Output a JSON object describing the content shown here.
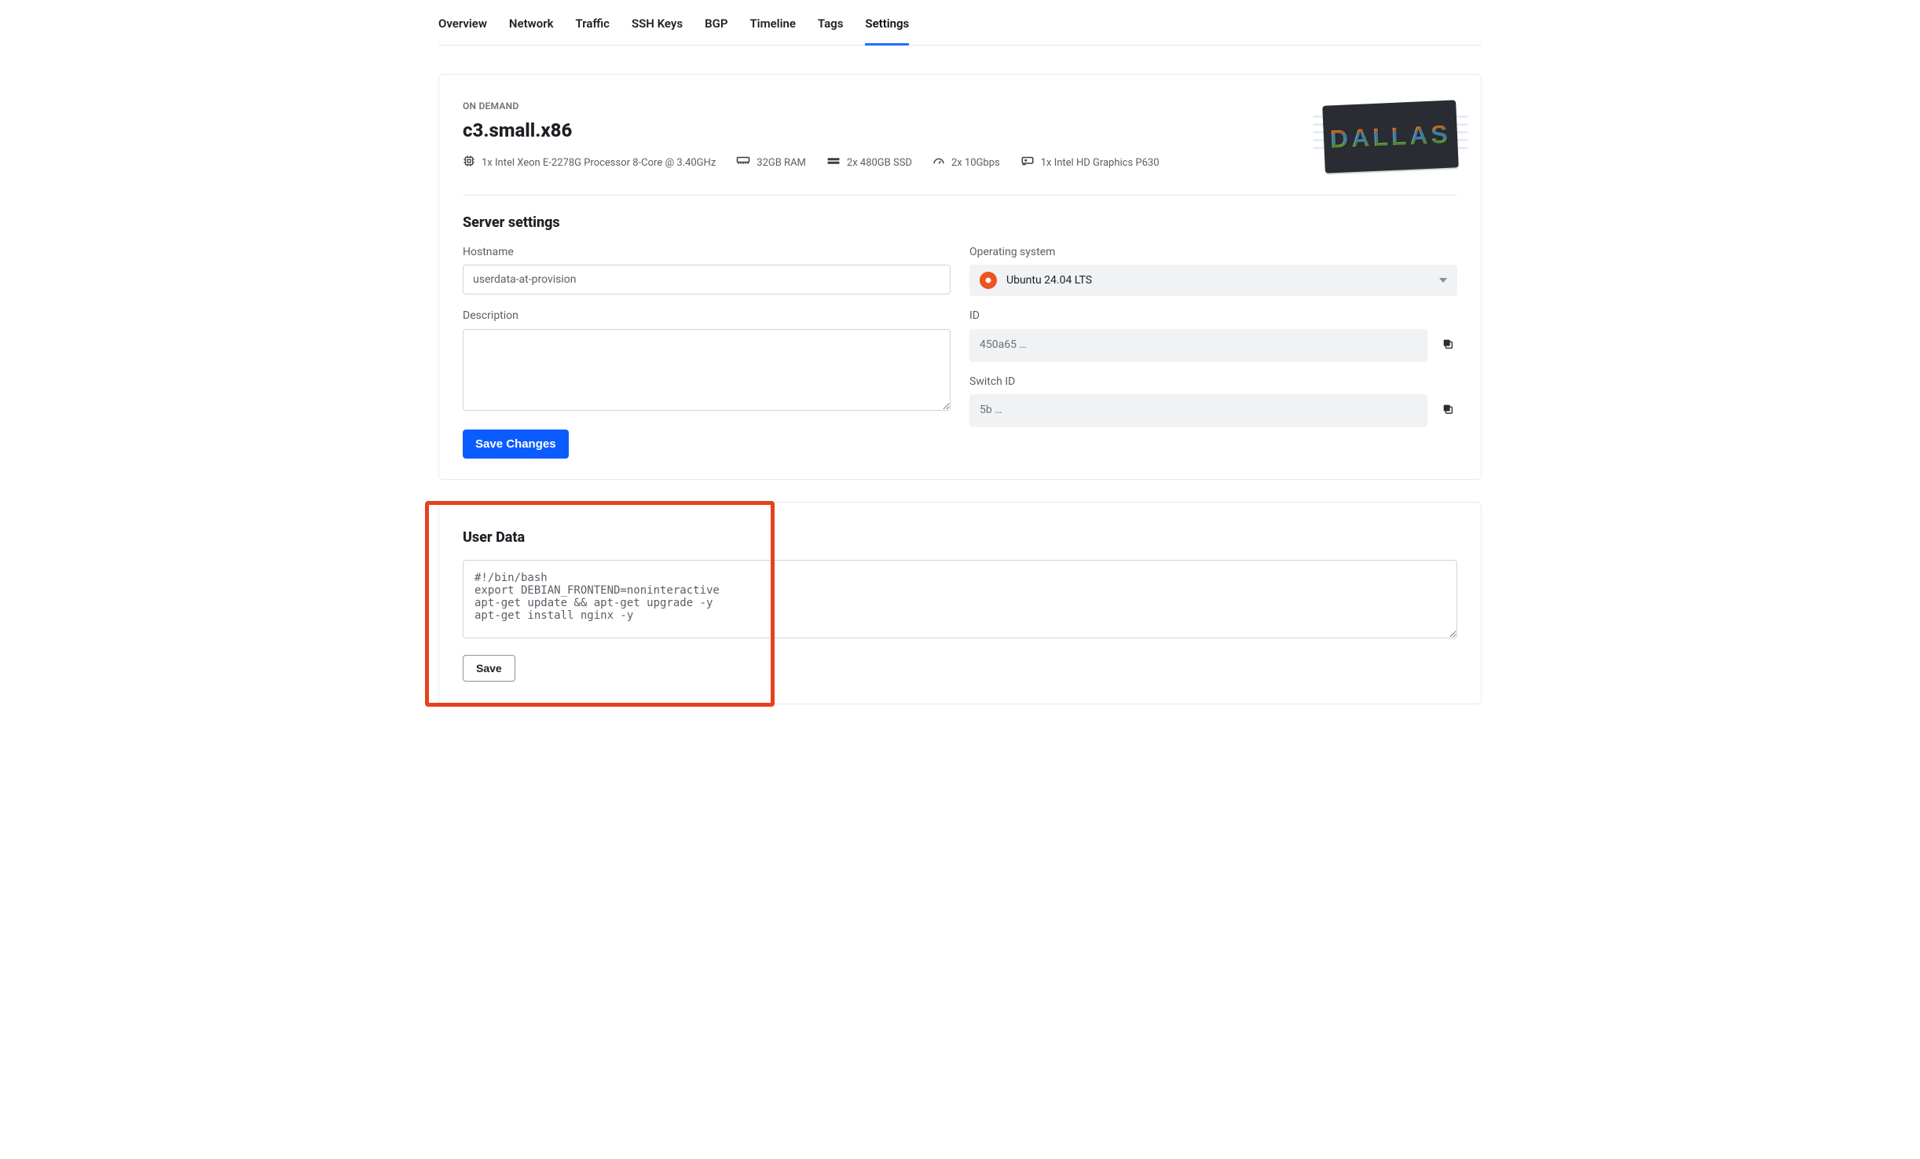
{
  "tabs": [
    "Overview",
    "Network",
    "Traffic",
    "SSH Keys",
    "BGP",
    "Timeline",
    "Tags",
    "Settings"
  ],
  "active_tab_index": 7,
  "header": {
    "eyebrow": "ON DEMAND",
    "title": "c3.small.x86",
    "specs": {
      "cpu": "1x Intel Xeon E-2278G Processor 8-Core @ 3.40GHz",
      "ram": "32GB RAM",
      "disk": "2x 480GB SSD",
      "nic": "2x 10Gbps",
      "gpu": "1x Intel HD Graphics P630"
    },
    "artwork_text": "DALLAS"
  },
  "settings": {
    "section_title": "Server settings",
    "labels": {
      "hostname": "Hostname",
      "description": "Description",
      "os": "Operating system",
      "id": "ID",
      "switch": "Switch ID"
    },
    "hostname": "userdata-at-provision",
    "description": "",
    "os_name": "Ubuntu 24.04 LTS",
    "id": "450a65 …",
    "switch_id": "5b …",
    "save_label": "Save Changes"
  },
  "userdata": {
    "section_title": "User Data",
    "script": "#!/bin/bash\nexport DEBIAN_FRONTEND=noninteractive\napt-get update && apt-get upgrade -y\napt-get install nginx -y",
    "save_label": "Save"
  }
}
